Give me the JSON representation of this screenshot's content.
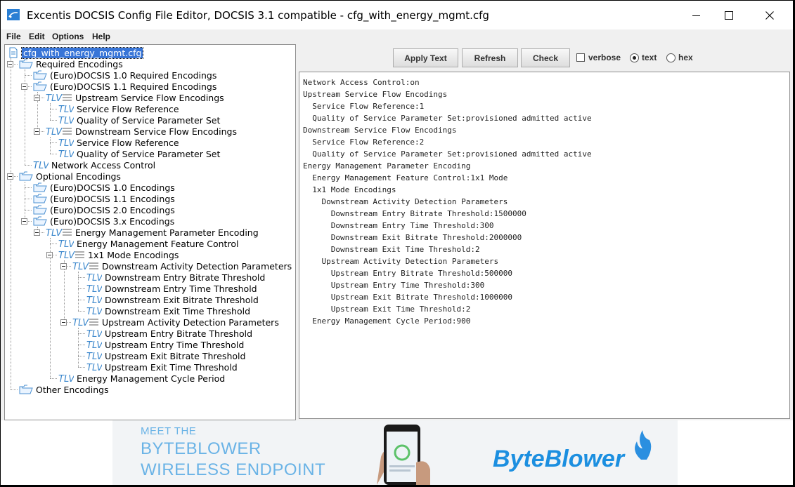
{
  "window": {
    "title": "Excentis DOCSIS Config File Editor, DOCSIS 3.1 compatible - cfg_with_energy_mgmt.cfg",
    "controls": [
      "minimize-icon",
      "maximize-icon",
      "close-icon"
    ]
  },
  "menu": [
    "File",
    "Edit",
    "Options",
    "Help"
  ],
  "tree": {
    "root": "cfg_with_energy_mgmt.cfg",
    "nodes": [
      {
        "label": "Required Encodings",
        "icon": "folder-open-icon"
      },
      {
        "label": "(Euro)DOCSIS 1.0 Required Encodings",
        "icon": "folder-open-icon"
      },
      {
        "label": "(Euro)DOCSIS 1.1 Required Encodings",
        "icon": "folder-open-icon"
      },
      {
        "label": "Upstream Service Flow Encodings",
        "icon": "tlv-list-icon"
      },
      {
        "label": "Service Flow Reference",
        "icon": "tlv-icon"
      },
      {
        "label": "Quality of Service Parameter Set",
        "icon": "tlv-icon"
      },
      {
        "label": "Downstream Service Flow Encodings",
        "icon": "tlv-list-icon"
      },
      {
        "label": "Service Flow Reference",
        "icon": "tlv-icon"
      },
      {
        "label": "Quality of Service Parameter Set",
        "icon": "tlv-icon"
      },
      {
        "label": "Network Access Control",
        "icon": "tlv-icon"
      },
      {
        "label": "Optional Encodings",
        "icon": "folder-open-icon"
      },
      {
        "label": "(Euro)DOCSIS 1.0 Encodings",
        "icon": "folder-open-icon"
      },
      {
        "label": "(Euro)DOCSIS 1.1 Encodings",
        "icon": "folder-open-icon"
      },
      {
        "label": "(Euro)DOCSIS 2.0 Encodings",
        "icon": "folder-open-icon"
      },
      {
        "label": "(Euro)DOCSIS 3.x Encodings",
        "icon": "folder-open-icon"
      },
      {
        "label": "Energy Management Parameter Encoding",
        "icon": "tlv-list-icon"
      },
      {
        "label": "Energy Management Feature Control",
        "icon": "tlv-icon"
      },
      {
        "label": "1x1 Mode Encodings",
        "icon": "tlv-list-icon"
      },
      {
        "label": "Downstream Activity Detection Parameters",
        "icon": "tlv-list-icon"
      },
      {
        "label": "Downstream Entry Bitrate Threshold",
        "icon": "tlv-icon"
      },
      {
        "label": "Downstream Entry Time Threshold",
        "icon": "tlv-icon"
      },
      {
        "label": "Downstream Exit Bitrate Threshold",
        "icon": "tlv-icon"
      },
      {
        "label": "Downstream Exit Time Threshold",
        "icon": "tlv-icon"
      },
      {
        "label": "Upstream Activity Detection Parameters",
        "icon": "tlv-list-icon"
      },
      {
        "label": "Upstream Entry Bitrate Threshold",
        "icon": "tlv-icon"
      },
      {
        "label": "Upstream Entry Time Threshold",
        "icon": "tlv-icon"
      },
      {
        "label": "Upstream Exit Bitrate Threshold",
        "icon": "tlv-icon"
      },
      {
        "label": "Upstream Exit Time Threshold",
        "icon": "tlv-icon"
      },
      {
        "label": "Energy Management Cycle Period",
        "icon": "tlv-icon"
      },
      {
        "label": "Other Encodings",
        "icon": "folder-open-icon"
      }
    ]
  },
  "toolbar": {
    "apply_text": "Apply Text",
    "refresh": "Refresh",
    "check": "Check",
    "verbose": "verbose",
    "verbose_checked": false,
    "text": "text",
    "hex": "hex",
    "selected_mode": "text"
  },
  "text_lines": [
    "Network Access Control:on",
    "Upstream Service Flow Encodings",
    "  Service Flow Reference:1",
    "  Quality of Service Parameter Set:provisioned admitted active",
    "Downstream Service Flow Encodings",
    "  Service Flow Reference:2",
    "  Quality of Service Parameter Set:provisioned admitted active",
    "Energy Management Parameter Encoding",
    "  Energy Management Feature Control:1x1 Mode",
    "  1x1 Mode Encodings",
    "    Downstream Activity Detection Parameters",
    "      Downstream Entry Bitrate Threshold:1500000",
    "      Downstream Entry Time Threshold:300",
    "      Downstream Exit Bitrate Threshold:2000000",
    "      Downstream Exit Time Threshold:2",
    "    Upstream Activity Detection Parameters",
    "      Upstream Entry Bitrate Threshold:500000",
    "      Upstream Entry Time Threshold:300",
    "      Upstream Exit Bitrate Threshold:1000000",
    "      Upstream Exit Time Threshold:2",
    "  Energy Management Cycle Period:900"
  ],
  "banner": {
    "line1": "MEET THE",
    "line2": "BYTEBLOWER",
    "line3": "WIRELESS ENDPOINT",
    "brand": "ByteBlower",
    "colors": {
      "text": "#6ab3e6",
      "brand": "#1c8fe0"
    }
  }
}
